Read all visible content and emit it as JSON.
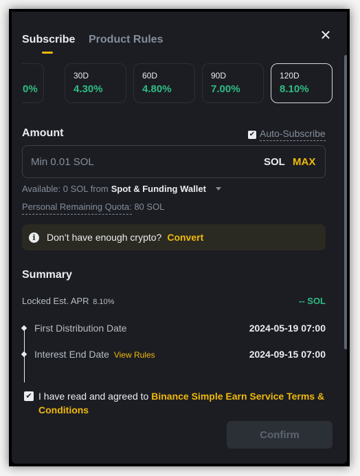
{
  "tabs": [
    {
      "label": "Subscribe",
      "active": true
    },
    {
      "label": "Product Rules",
      "active": false
    }
  ],
  "durations": [
    {
      "days": "",
      "rate": "0%",
      "partial": true
    },
    {
      "days": "30D",
      "rate": "4.30%"
    },
    {
      "days": "60D",
      "rate": "4.80%"
    },
    {
      "days": "90D",
      "rate": "7.00%"
    },
    {
      "days": "120D",
      "rate": "8.10%",
      "selected": true
    }
  ],
  "amount": {
    "label": "Amount",
    "auto_subscribe_label": "Auto-Subscribe",
    "auto_subscribe_checked": true,
    "input_placeholder": "Min 0.01 SOL",
    "input_value": "",
    "unit": "SOL",
    "max_label": "MAX",
    "available_text": "Available: 0 SOL from",
    "wallet": "Spot & Funding Wallet",
    "quota_label": "Personal Remaining Quota:",
    "quota_value": "80 SOL"
  },
  "alert": {
    "message": "Don’t have enough crypto?",
    "action": "Convert"
  },
  "summary": {
    "title": "Summary",
    "apr_label": "Locked Est. APR",
    "apr_value": "8.10%",
    "est_earnings": "-- SOL",
    "first_distribution_label": "First Distribution Date",
    "first_distribution_date": "2024-05-19 07:00",
    "interest_end_label": "Interest End Date",
    "view_rules_label": "View Rules",
    "interest_end_date": "2024-09-15 07:00"
  },
  "agreement": {
    "checked": true,
    "text": "I have read and agreed to ",
    "link": "Binance Simple Earn Service Terms & Conditions"
  },
  "confirm_label": "Confirm",
  "colors": {
    "accent": "#f0b90b",
    "positive": "#2ebd85",
    "background": "#1c1d22"
  }
}
